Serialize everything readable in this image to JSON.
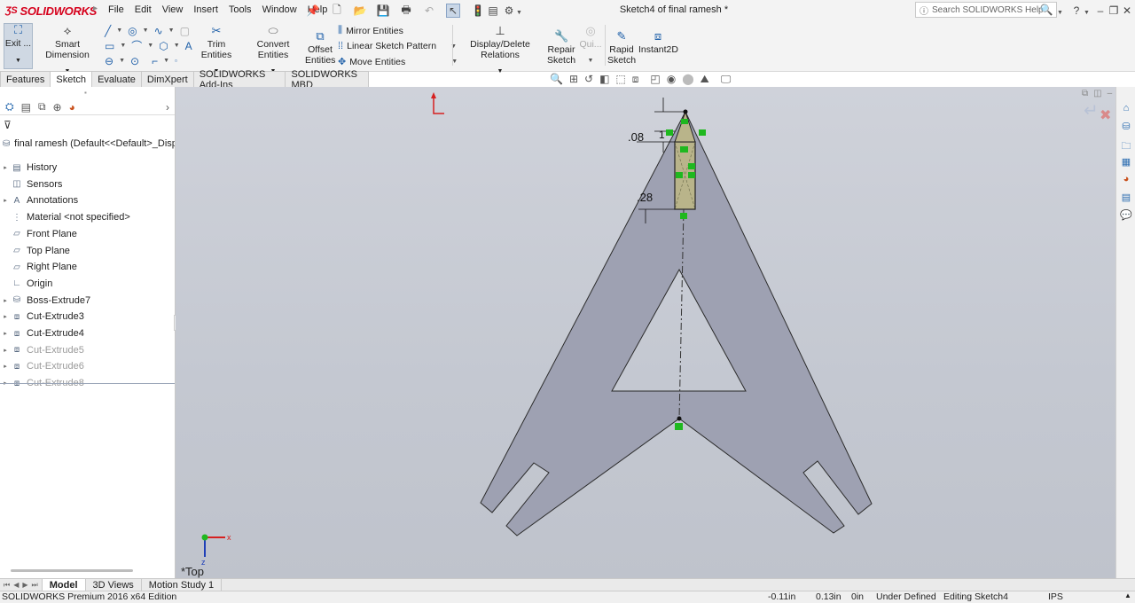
{
  "app": {
    "brand": "SOLIDWORKS",
    "document_title": "Sketch4 of final ramesh *"
  },
  "menu": [
    "File",
    "Edit",
    "View",
    "Insert",
    "Tools",
    "Window",
    "Help"
  ],
  "search": {
    "placeholder": "Search SOLIDWORKS Help"
  },
  "commands": {
    "exit": "Exit ...",
    "smart_dimension": "Smart Dimension",
    "trim": "Trim Entities",
    "convert": "Convert Entities",
    "offset": "Offset Entities",
    "mirror": "Mirror Entities",
    "linear_pattern": "Linear Sketch Pattern",
    "move": "Move Entities",
    "display_relations": "Display/Delete Relations",
    "repair": "Repair Sketch",
    "quick": "Qui...",
    "rapid": "Rapid Sketch",
    "instant2d": "Instant2D"
  },
  "tabs": [
    "Features",
    "Sketch",
    "Evaluate",
    "DimXpert",
    "SOLIDWORKS Add-Ins",
    "SOLIDWORKS MBD"
  ],
  "active_tab": "Sketch",
  "tree": {
    "root": "final ramesh  (Default<<Default>_Displa",
    "items": [
      {
        "label": "History",
        "icon": "history-folder-icon",
        "expand": true,
        "dim": false
      },
      {
        "label": "Sensors",
        "icon": "sensors-icon",
        "expand": false,
        "dim": false
      },
      {
        "label": "Annotations",
        "icon": "annotations-icon",
        "expand": true,
        "dim": false
      },
      {
        "label": "Material <not specified>",
        "icon": "material-icon",
        "expand": false,
        "dim": false
      },
      {
        "label": "Front Plane",
        "icon": "plane-icon",
        "expand": false,
        "dim": false
      },
      {
        "label": "Top Plane",
        "icon": "plane-icon",
        "expand": false,
        "dim": false
      },
      {
        "label": "Right Plane",
        "icon": "plane-icon",
        "expand": false,
        "dim": false
      },
      {
        "label": "Origin",
        "icon": "origin-icon",
        "expand": false,
        "dim": false
      },
      {
        "label": "Boss-Extrude7",
        "icon": "extrude-icon",
        "expand": true,
        "dim": false
      },
      {
        "label": "Cut-Extrude3",
        "icon": "cut-extrude-icon",
        "expand": true,
        "dim": false
      },
      {
        "label": "Cut-Extrude4",
        "icon": "cut-extrude-icon",
        "expand": true,
        "dim": false
      },
      {
        "label": "Cut-Extrude5",
        "icon": "cut-extrude-icon",
        "expand": true,
        "dim": true
      },
      {
        "label": "Cut-Extrude6",
        "icon": "cut-extrude-icon",
        "expand": true,
        "dim": true
      },
      {
        "label": "Cut-Extrude8",
        "icon": "cut-extrude-icon",
        "expand": true,
        "dim": true
      }
    ]
  },
  "sketch": {
    "dim_top": ".08",
    "dim_small": "1",
    "dim_lower": ".28",
    "view_label": "*Top"
  },
  "bottom_tabs": [
    "Model",
    "3D Views",
    "Motion Study 1"
  ],
  "status": {
    "edition": "SOLIDWORKS Premium 2016 x64 Edition",
    "x": "-0.11in",
    "y": "0.13in",
    "z": "0in",
    "state": "Under Defined",
    "editing": "Editing Sketch4",
    "units": "IPS"
  },
  "colors": {
    "part_fill": "#9ea1b2",
    "sketch_fill": "#b9b48a",
    "relation_green": "#1fb81f"
  }
}
